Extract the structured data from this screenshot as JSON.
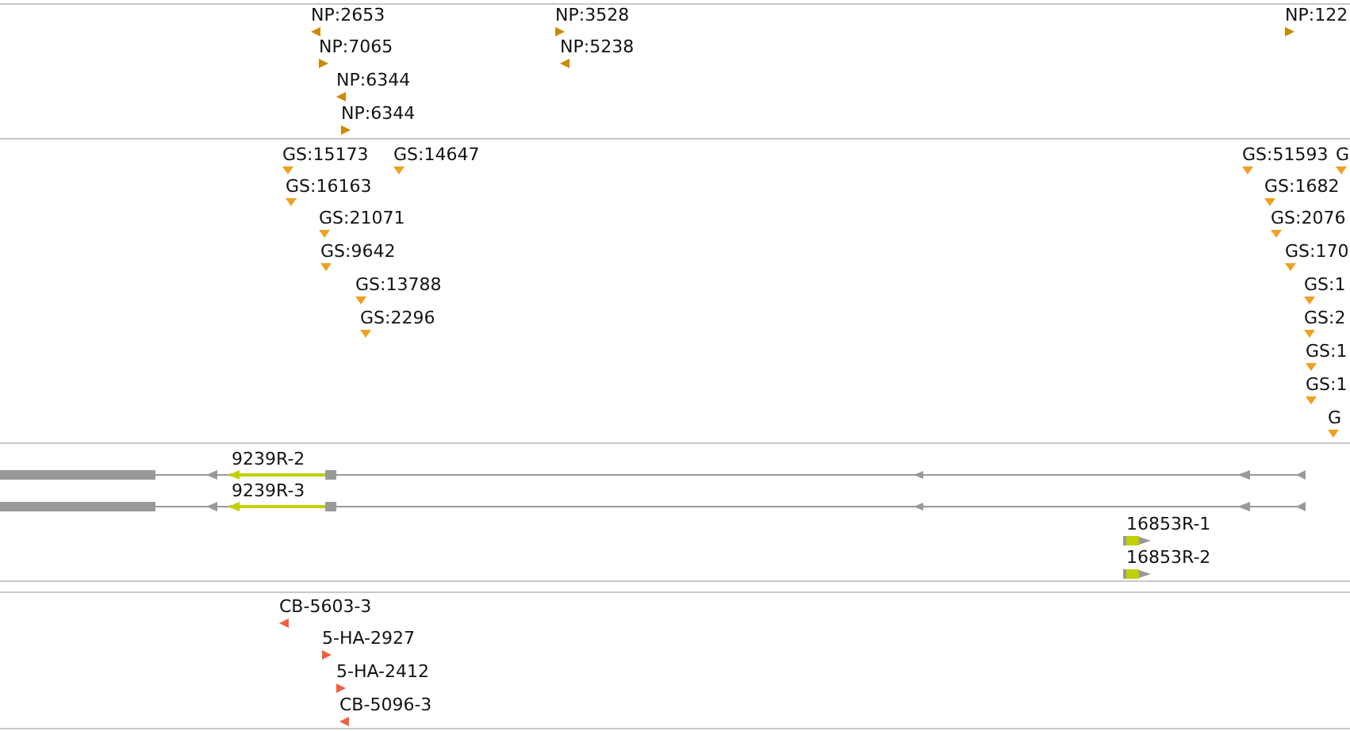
{
  "tracks": [
    {
      "kind": "markers",
      "color": "#cc8a00",
      "features": [
        {
          "label": "NP:2653",
          "reverse": true
        },
        {
          "label": "NP:7065",
          "reverse": false
        },
        {
          "label": "NP:6344",
          "reverse": true
        },
        {
          "label": "NP:6344",
          "reverse": false
        },
        {
          "label": "NP:3528",
          "reverse": false
        },
        {
          "label": "NP:5238",
          "reverse": true
        },
        {
          "label": "NP:122",
          "reverse": false
        }
      ]
    },
    {
      "kind": "markers",
      "color": "#f0a020",
      "features": [
        {
          "label": "GS:15173"
        },
        {
          "label": "GS:14647"
        },
        {
          "label": "GS:16163"
        },
        {
          "label": "GS:21071"
        },
        {
          "label": "GS:9642"
        },
        {
          "label": "GS:13788"
        },
        {
          "label": "GS:2296"
        },
        {
          "label": "GS:51593"
        },
        {
          "label": "G"
        },
        {
          "label": "GS:1682"
        },
        {
          "label": "GS:2076"
        },
        {
          "label": "GS:170"
        },
        {
          "label": "GS:1"
        },
        {
          "label": "GS:2"
        },
        {
          "label": "GS:1"
        },
        {
          "label": "GS:1"
        },
        {
          "label": "G"
        }
      ]
    },
    {
      "kind": "transcripts",
      "color": "#c0d000",
      "features": [
        {
          "label": "9239R-2",
          "kind": "spliced"
        },
        {
          "label": "9239R-3",
          "kind": "spliced"
        },
        {
          "label": "16853R-1",
          "kind": "short"
        },
        {
          "label": "16853R-2",
          "kind": "short"
        }
      ]
    },
    {
      "kind": "markers",
      "color": "#f06040",
      "features": [
        {
          "label": "CB-5603-3",
          "reverse": true
        },
        {
          "label": "5-HA-2927",
          "reverse": false
        },
        {
          "label": "5-HA-2412",
          "reverse": false
        },
        {
          "label": "CB-5096-3",
          "reverse": true
        }
      ]
    }
  ]
}
